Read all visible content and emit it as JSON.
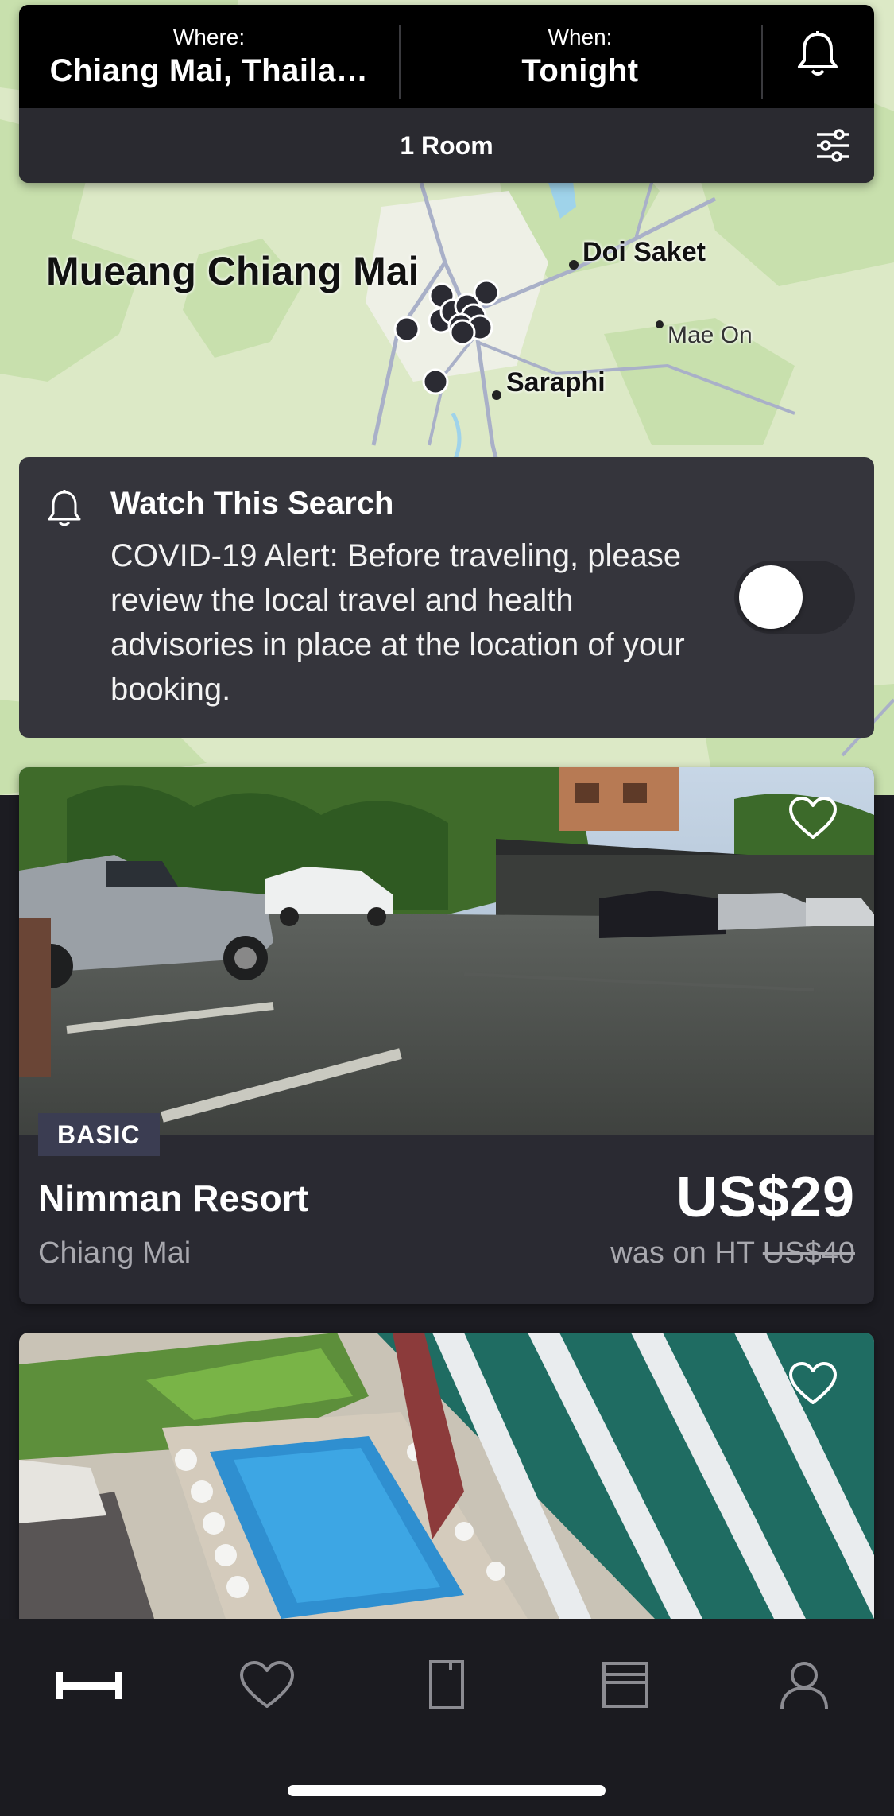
{
  "search": {
    "where_label": "Where:",
    "where_value": "Chiang Mai, Thaila…",
    "when_label": "When:",
    "when_value": "Tonight",
    "rooms": "1 Room"
  },
  "map": {
    "labels": {
      "mueang": "Mueang Chiang Mai",
      "doi_saket": "Doi Saket",
      "mae_on": "Mae On",
      "saraphi": "Saraphi"
    }
  },
  "watch": {
    "title": "Watch This Search",
    "body": "COVID-19 Alert: Before traveling, please review the local travel and health advisories in place at the location of your booking.",
    "enabled": false
  },
  "hotels": [
    {
      "badge": "BASIC",
      "name": "Nimman Resort",
      "city": "Chiang Mai",
      "price": "US$29",
      "was_prefix": "was on HT",
      "was_price": "US$40"
    }
  ],
  "icons": {
    "search_bell": "bell-icon",
    "filter": "sliders-icon",
    "watch_bell": "bell-outline-icon",
    "favorite": "heart-outline-icon",
    "tabs": [
      "bed-icon",
      "heart-icon",
      "booking-icon",
      "gift-box-icon",
      "profile-icon"
    ]
  },
  "colors": {
    "background": "#1c1c22",
    "card": "#2a2a32",
    "badge": "#3b3d52",
    "map_land": "#dce9c6"
  }
}
